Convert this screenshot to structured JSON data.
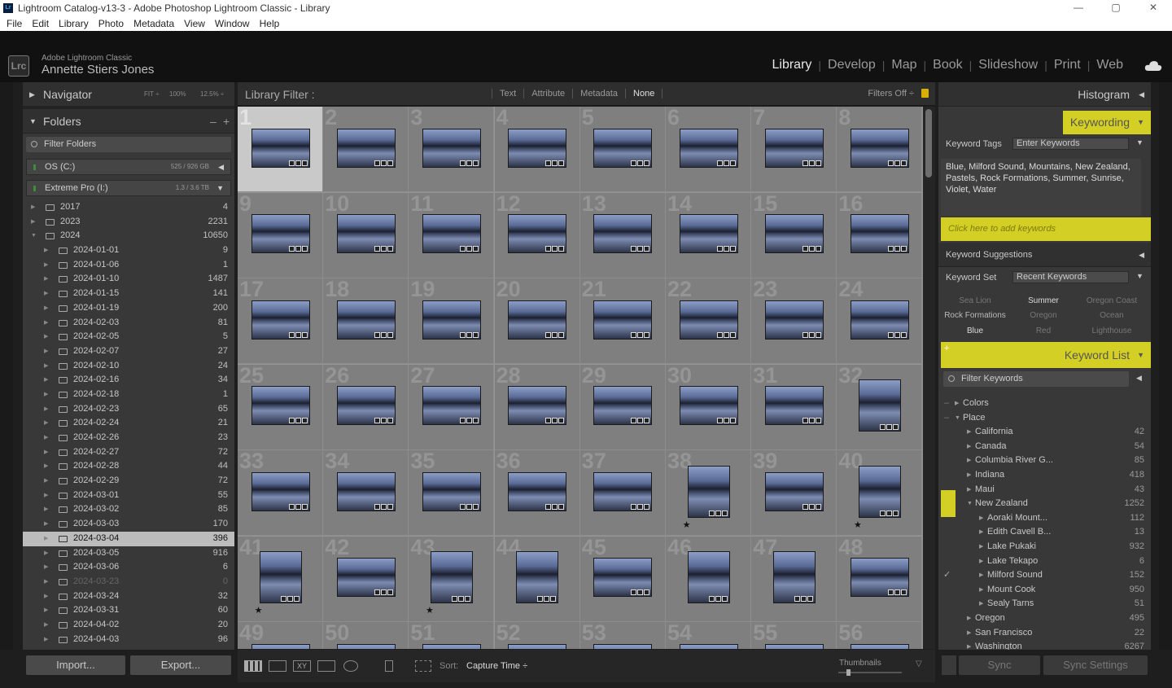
{
  "window": {
    "title": "Lightroom Catalog-v13-3 - Adobe Photoshop Lightroom Classic - Library",
    "min": "—",
    "max": "▢",
    "close": "✕"
  },
  "menu": [
    "File",
    "Edit",
    "Library",
    "Photo",
    "Metadata",
    "View",
    "Window",
    "Help"
  ],
  "brand": {
    "logo": "Lrc",
    "app": "Adobe Lightroom Classic",
    "user": "Annette Stiers Jones"
  },
  "modules": [
    "Library",
    "Develop",
    "Map",
    "Book",
    "Slideshow",
    "Print",
    "Web"
  ],
  "active_module": "Library",
  "navigator": {
    "title": "Navigator",
    "fit": "FIT ÷",
    "z100": "100%",
    "z125": "12.5% ÷"
  },
  "folders": {
    "title": "Folders",
    "filter_placeholder": "Filter Folders",
    "volumes": [
      {
        "name": "OS (C:)",
        "capacity": "525 / 926 GB"
      },
      {
        "name": "Extreme Pro (I:)",
        "capacity": "1.3 / 3.6 TB"
      }
    ],
    "years": [
      {
        "name": "2017",
        "count": "4"
      },
      {
        "name": "2023",
        "count": "2231"
      },
      {
        "name": "2024",
        "count": "10650"
      }
    ],
    "items": [
      {
        "name": "2024-01-01",
        "count": "9"
      },
      {
        "name": "2024-01-06",
        "count": "1"
      },
      {
        "name": "2024-01-10",
        "count": "1487"
      },
      {
        "name": "2024-01-15",
        "count": "141"
      },
      {
        "name": "2024-01-19",
        "count": "200"
      },
      {
        "name": "2024-02-03",
        "count": "81"
      },
      {
        "name": "2024-02-05",
        "count": "5"
      },
      {
        "name": "2024-02-07",
        "count": "27"
      },
      {
        "name": "2024-02-10",
        "count": "24"
      },
      {
        "name": "2024-02-16",
        "count": "34"
      },
      {
        "name": "2024-02-18",
        "count": "1"
      },
      {
        "name": "2024-02-23",
        "count": "65"
      },
      {
        "name": "2024-02-24",
        "count": "21"
      },
      {
        "name": "2024-02-26",
        "count": "23"
      },
      {
        "name": "2024-02-27",
        "count": "72"
      },
      {
        "name": "2024-02-28",
        "count": "44"
      },
      {
        "name": "2024-02-29",
        "count": "72"
      },
      {
        "name": "2024-03-01",
        "count": "55"
      },
      {
        "name": "2024-03-02",
        "count": "85"
      },
      {
        "name": "2024-03-03",
        "count": "170"
      },
      {
        "name": "2024-03-04",
        "count": "396",
        "selected": true
      },
      {
        "name": "2024-03-05",
        "count": "916"
      },
      {
        "name": "2024-03-06",
        "count": "6"
      },
      {
        "name": "2024-03-23",
        "count": "0",
        "dim": true
      },
      {
        "name": "2024-03-24",
        "count": "32"
      },
      {
        "name": "2024-03-31",
        "count": "60"
      },
      {
        "name": "2024-04-02",
        "count": "20"
      },
      {
        "name": "2024-04-03",
        "count": "96"
      }
    ]
  },
  "left_buttons": {
    "import": "Import...",
    "export": "Export..."
  },
  "library_filter": {
    "label": "Library Filter :",
    "options": [
      "Text",
      "Attribute",
      "Metadata",
      "None"
    ],
    "active": "None",
    "status": "Filters Off ÷"
  },
  "grid": {
    "columns": 8,
    "rows": 7,
    "selected_index": 1,
    "portrait": [
      32,
      38,
      40,
      41,
      43,
      44,
      46,
      47
    ],
    "starred": [
      38,
      40,
      41,
      43
    ]
  },
  "toolbar": {
    "sort_label": "Sort:",
    "sort_value": "Capture Time ÷",
    "thumbnails_label": "Thumbnails"
  },
  "right": {
    "histogram": "Histogram",
    "keywording": "Keywording",
    "keyword_tags_label": "Keyword Tags",
    "keyword_tags_select": "Enter Keywords",
    "keywords_text": "Blue, Milford Sound, Mountains, New Zealand, Pastels, Rock Formations, Summer, Sunrise, Violet, Water",
    "add_keywords_placeholder": "Click here to add keywords",
    "keyword_suggestions": "Keyword Suggestions",
    "keyword_set_label": "Keyword Set",
    "keyword_set_select": "Recent Keywords",
    "recent": [
      [
        "Sea Lion",
        "Summer",
        "Oregon Coast"
      ],
      [
        "Rock Formations",
        "Oregon",
        "Ocean"
      ],
      [
        "Blue",
        "Red",
        "Lighthouse"
      ]
    ],
    "keyword_list": "Keyword List",
    "filter_keywords": "Filter Keywords",
    "tree": [
      {
        "name": "Colors",
        "count": "",
        "level": 0
      },
      {
        "name": "Place",
        "count": "",
        "level": 0,
        "open": true
      },
      {
        "name": "California",
        "count": "42",
        "level": 1
      },
      {
        "name": "Canada",
        "count": "54",
        "level": 1
      },
      {
        "name": "Columbia River G...",
        "count": "85",
        "level": 1
      },
      {
        "name": "Indiana",
        "count": "418",
        "level": 1
      },
      {
        "name": "Maui",
        "count": "43",
        "level": 1
      },
      {
        "name": "New Zealand",
        "count": "1252",
        "level": 1,
        "open": true,
        "highlight": true
      },
      {
        "name": "Aoraki Mount...",
        "count": "112",
        "level": 2
      },
      {
        "name": "Edith Cavell B...",
        "count": "13",
        "level": 2
      },
      {
        "name": "Lake Pukaki",
        "count": "932",
        "level": 2
      },
      {
        "name": "Lake Tekapo",
        "count": "6",
        "level": 2
      },
      {
        "name": "Milford Sound",
        "count": "152",
        "level": 2,
        "checked": true
      },
      {
        "name": "Mount Cook",
        "count": "950",
        "level": 2
      },
      {
        "name": "Sealy Tarns",
        "count": "51",
        "level": 2
      },
      {
        "name": "Oregon",
        "count": "495",
        "level": 1
      },
      {
        "name": "San Francisco",
        "count": "22",
        "level": 1
      },
      {
        "name": "Washington",
        "count": "6267",
        "level": 1
      }
    ]
  },
  "right_buttons": {
    "sync": "Sync",
    "sync_settings": "Sync Settings"
  }
}
